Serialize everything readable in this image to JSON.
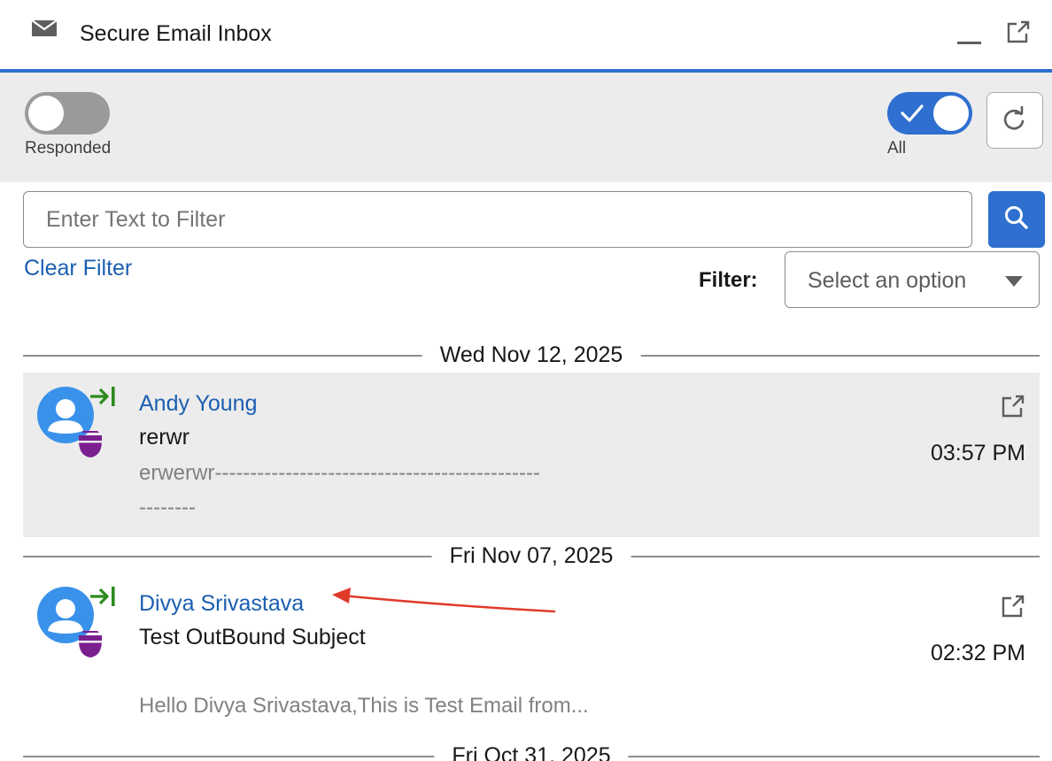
{
  "window": {
    "title": "Secure Email Inbox"
  },
  "toolbar": {
    "responded_label": "Responded",
    "responded_on": false,
    "all_label": "All",
    "all_on": true
  },
  "search": {
    "placeholder": "Enter Text to Filter",
    "value": "",
    "clear_label": "Clear Filter",
    "filter_label": "Filter:",
    "filter_placeholder": "Select an option"
  },
  "groups": [
    {
      "date": "Wed Nov 12, 2025",
      "emails": [
        {
          "sender": "Andy Young",
          "subject": "rerwr",
          "preview": "erwerwr----------------------------------------------\n--------",
          "time": "03:57 PM",
          "selected": true
        }
      ]
    },
    {
      "date": "Fri Nov 07, 2025",
      "emails": [
        {
          "sender": "Divya Srivastava",
          "subject": "Test OutBound Subject",
          "preview": "Hello Divya Srivastava,This is Test Email from...",
          "time": "02:32 PM",
          "selected": false
        }
      ]
    },
    {
      "date": "Fri Oct 31, 2025",
      "emails": []
    }
  ],
  "colors": {
    "accent": "#2e6fd0",
    "link": "#1b5fb1",
    "outbound_arrow": "#2e8a1f",
    "badge": "#7b1f8f",
    "annotation": "#e03a2a"
  }
}
